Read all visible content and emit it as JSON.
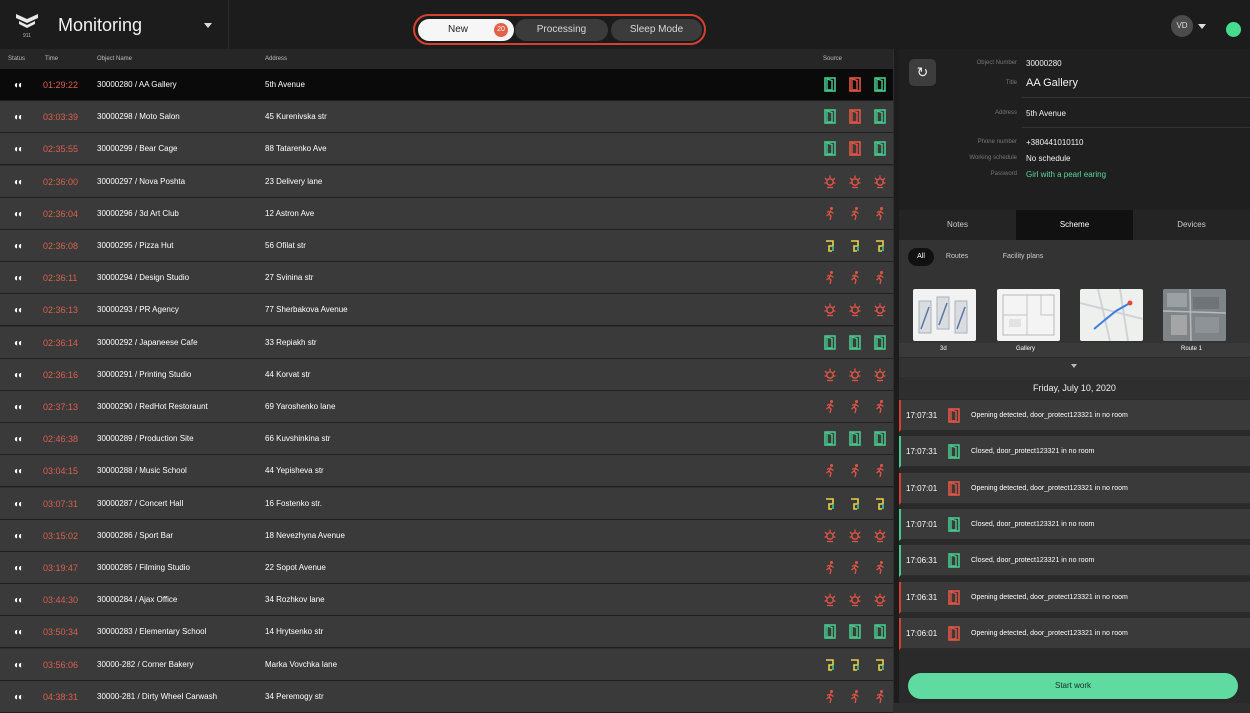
{
  "header": {
    "app_title": "Monitoring",
    "tabs": [
      {
        "label": "New",
        "badge": "20"
      },
      {
        "label": "Processing"
      },
      {
        "label": "Sleep Mode"
      }
    ],
    "user_initials": "VD",
    "colors": {
      "accent": "#d5402f",
      "online": "#46dc8e"
    }
  },
  "list": {
    "columns": {
      "status": "Status",
      "time": "Time",
      "object_name": "Object Name",
      "address": "Address",
      "source": "Source"
    },
    "rows": [
      {
        "status": "◐◐",
        "time": "01:29:22",
        "object": "30000280 / AA Gallery",
        "address": "5th Avenue",
        "source": "door-green,door-red,door-green"
      },
      {
        "status": "◐◐",
        "time": "03:03:39",
        "object": "30000298 / Moto Salon",
        "address": "45 Kurenivska str",
        "source": "door-green,door-red,door-green"
      },
      {
        "status": "◐◐",
        "time": "02:35:55",
        "object": "30000299 / Bear Cage",
        "address": "88 Tatarenko Ave",
        "source": "door-green,door-red,door-green"
      },
      {
        "status": "◐◐",
        "time": "02:36:00",
        "object": "30000297 / Nova Poshta",
        "address": "23 Delivery lane",
        "source": "alarm,alarm,alarm"
      },
      {
        "status": "◐◐",
        "time": "02:36:04",
        "object": "30000296 / 3d Art Club",
        "address": "12 Astron Ave",
        "source": "motion,motion,motion"
      },
      {
        "status": "◐◐",
        "time": "02:36:08",
        "object": "30000295 / Pizza Hut",
        "address": "56 Ofilat str",
        "source": "leak,leak,leak"
      },
      {
        "status": "◐◐",
        "time": "02:36:11",
        "object": "30000294 / Design Studio",
        "address": "27 Svinina str",
        "source": "motion,motion,motion"
      },
      {
        "status": "◐◐",
        "time": "02:36:13",
        "object": "30000293 / PR Agency",
        "address": "77 Sherbakova Avenue",
        "source": "alarm,alarm,alarm"
      },
      {
        "status": "◐◐",
        "time": "02:36:14",
        "object": "30000292 / Japaneese Cafe",
        "address": "33 Repiakh str",
        "source": "door-green,door-green,door-green"
      },
      {
        "status": "◐◐",
        "time": "02:36:16",
        "object": "30000291 / Printing Studio",
        "address": "44 Korvat str",
        "source": "alarm,alarm,alarm"
      },
      {
        "status": "◐◐",
        "time": "02:37:13",
        "object": "30000290 / RedHot Restoraunt",
        "address": "69 Yaroshenko lane",
        "source": "motion,motion,motion"
      },
      {
        "status": "◐◐",
        "time": "02:46:38",
        "object": "30000289 / Production Site",
        "address": "66 Kuvshinkina str",
        "source": "door-green,door-green,door-green"
      },
      {
        "status": "◐◐",
        "time": "03:04:15",
        "object": "30000288 / Music School",
        "address": "44 Yepisheva str",
        "source": "motion,motion,motion"
      },
      {
        "status": "◐◐",
        "time": "03:07:31",
        "object": "30000287 / Concert Hall",
        "address": "16 Fostenko str.",
        "source": "leak,leak,leak"
      },
      {
        "status": "◐◐",
        "time": "03:15:02",
        "object": "30000286 / Sport Bar",
        "address": "18 Nevezhyna Avenue",
        "source": "alarm,alarm,alarm"
      },
      {
        "status": "◐◐",
        "time": "03:19:47",
        "object": "30000285 / Filming Studio",
        "address": "22 Sopot Avenue",
        "source": "motion,motion,motion"
      },
      {
        "status": "◐◐",
        "time": "03:44:30",
        "object": "30000284 / Ajax Office",
        "address": "34 Rozhkov lane",
        "source": "alarm,alarm,alarm"
      },
      {
        "status": "◐◐",
        "time": "03:50:34",
        "object": "30000283 / Elementary School",
        "address": "14 Hrytsenko str",
        "source": "door-green,door-green,door-green"
      },
      {
        "status": "◐◐",
        "time": "03:56:06",
        "object": "30000-282 / Corner Bakery",
        "address": "Marka Vovchka lane",
        "source": "leak,leak,leak"
      },
      {
        "status": "◐◐",
        "time": "04:38:31",
        "object": "30000-281 / Dirty Wheel Carwash",
        "address": "34 Peremogy str",
        "source": "motion,motion,motion"
      }
    ]
  },
  "details": {
    "refresh_icon": "↻",
    "object_number_label": "Object Number",
    "object_number": "30000280",
    "title_label": "Title",
    "title": "AA Gallery",
    "address_label": "Address",
    "address": "5th Avenue",
    "phone_label": "Phone number",
    "phone": "+380441010110",
    "schedule_label": "Working schedule",
    "schedule": "No schedule",
    "password_label": "Password",
    "password": "Girl with a pearl earing",
    "tabs": [
      "Notes",
      "Scheme",
      "Devices"
    ],
    "filters": [
      "All",
      "Routes",
      "Facility plans"
    ],
    "thumbnails": [
      "3d",
      "Gallery",
      "",
      "Route 1"
    ],
    "date": "Friday, July 10, 2020",
    "events": [
      {
        "time": "17:07:31",
        "kind": "red",
        "text": "Opening detected, door_protect123321 in no room"
      },
      {
        "time": "17:07:31",
        "kind": "green",
        "text": "Closed, door_protect123321 in no room"
      },
      {
        "time": "17:07:01",
        "kind": "red",
        "text": "Opening detected, door_protect123321 in no room"
      },
      {
        "time": "17:07:01",
        "kind": "green",
        "text": "Closed, door_protect123321 in no room"
      },
      {
        "time": "17:06:31",
        "kind": "green",
        "text": "Closed, door_protect123321 in no room"
      },
      {
        "time": "17:06:31",
        "kind": "red",
        "text": "Opening detected, door_protect123321 in no room"
      },
      {
        "time": "17:06:01",
        "kind": "red",
        "text": "Opening detected, door_protect123321 in no room"
      }
    ],
    "start_button": "Start work"
  }
}
